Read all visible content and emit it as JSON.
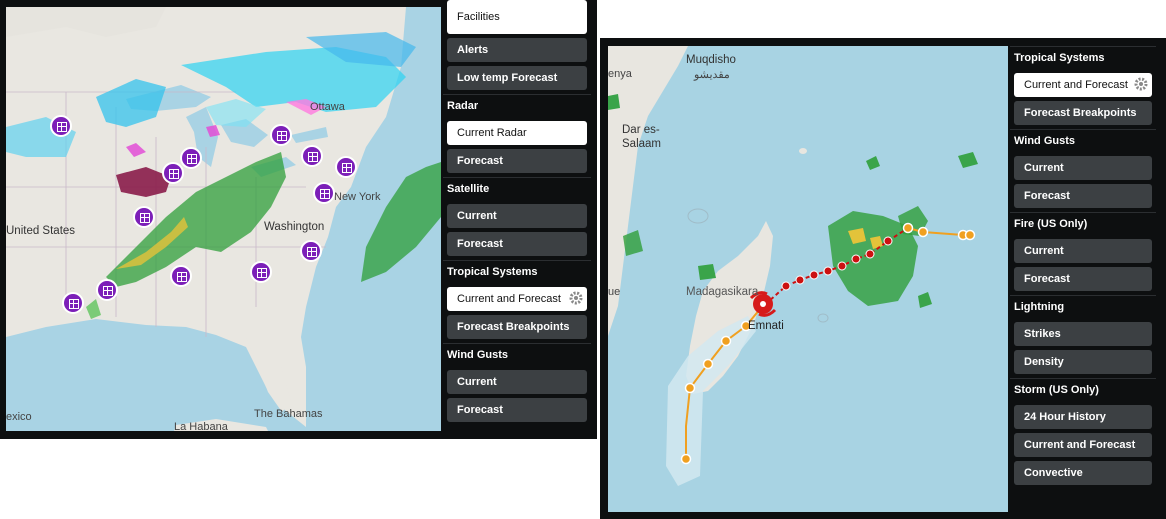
{
  "left_window": {
    "map_labels": {
      "ottawa": "Ottawa",
      "united_states": "United States",
      "washington": "Washington",
      "new_york": "New York",
      "la_habana": "La Habana",
      "the_bahamas": "The Bahamas",
      "mexico": "exico"
    },
    "sidebar": {
      "facilities": "Facilities",
      "alerts": "Alerts",
      "low_temp_forecast": "Low temp Forecast",
      "radar_title": "Radar",
      "current_radar": "Current Radar",
      "radar_forecast": "Forecast",
      "satellite_title": "Satellite",
      "satellite_current": "Current",
      "satellite_forecast": "Forecast",
      "tropical_title": "Tropical Systems",
      "tropical_current_forecast": "Current and Forecast",
      "forecast_breakpoints": "Forecast Breakpoints",
      "wind_gusts_title": "Wind Gusts",
      "wind_current": "Current",
      "wind_forecast": "Forecast"
    }
  },
  "right_window": {
    "map_labels": {
      "kenya": "enya",
      "muqdisho": "Muqdisho",
      "muqdisho_arabic": "مقديشو",
      "dar_es_salaam_1": "Dar es-",
      "dar_es_salaam_2": "Salaam",
      "madagasikara": "Madagasikara",
      "emnati": "Emnati",
      "ue": "ue"
    },
    "sidebar": {
      "tropical_title": "Tropical Systems",
      "tropical_current_forecast": "Current and Forecast",
      "forecast_breakpoints": "Forecast Breakpoints",
      "wind_gusts_title": "Wind Gusts",
      "wind_current": "Current",
      "wind_forecast": "Forecast",
      "fire_title": "Fire (US Only)",
      "fire_current": "Current",
      "fire_forecast": "Forecast",
      "lightning_title": "Lightning",
      "strikes": "Strikes",
      "density": "Density",
      "storm_title": "Storm (US Only)",
      "history_24h": "24 Hour History",
      "storm_current_forecast": "Current and Forecast",
      "convective": "Convective"
    }
  },
  "colors": {
    "panel_bg": "#0d0f10",
    "button_bg": "#3c4043",
    "active_bg": "#ffffff",
    "ocean": "#a8d3e3",
    "land": "#e9e7e1",
    "facility_pin": "#7c1fb8",
    "storm_track_past": "#cc1111",
    "storm_track_forecast": "#f0a020"
  },
  "icons": {
    "facility": "building-icon",
    "settings": "gear-icon",
    "storm": "hurricane-icon"
  }
}
